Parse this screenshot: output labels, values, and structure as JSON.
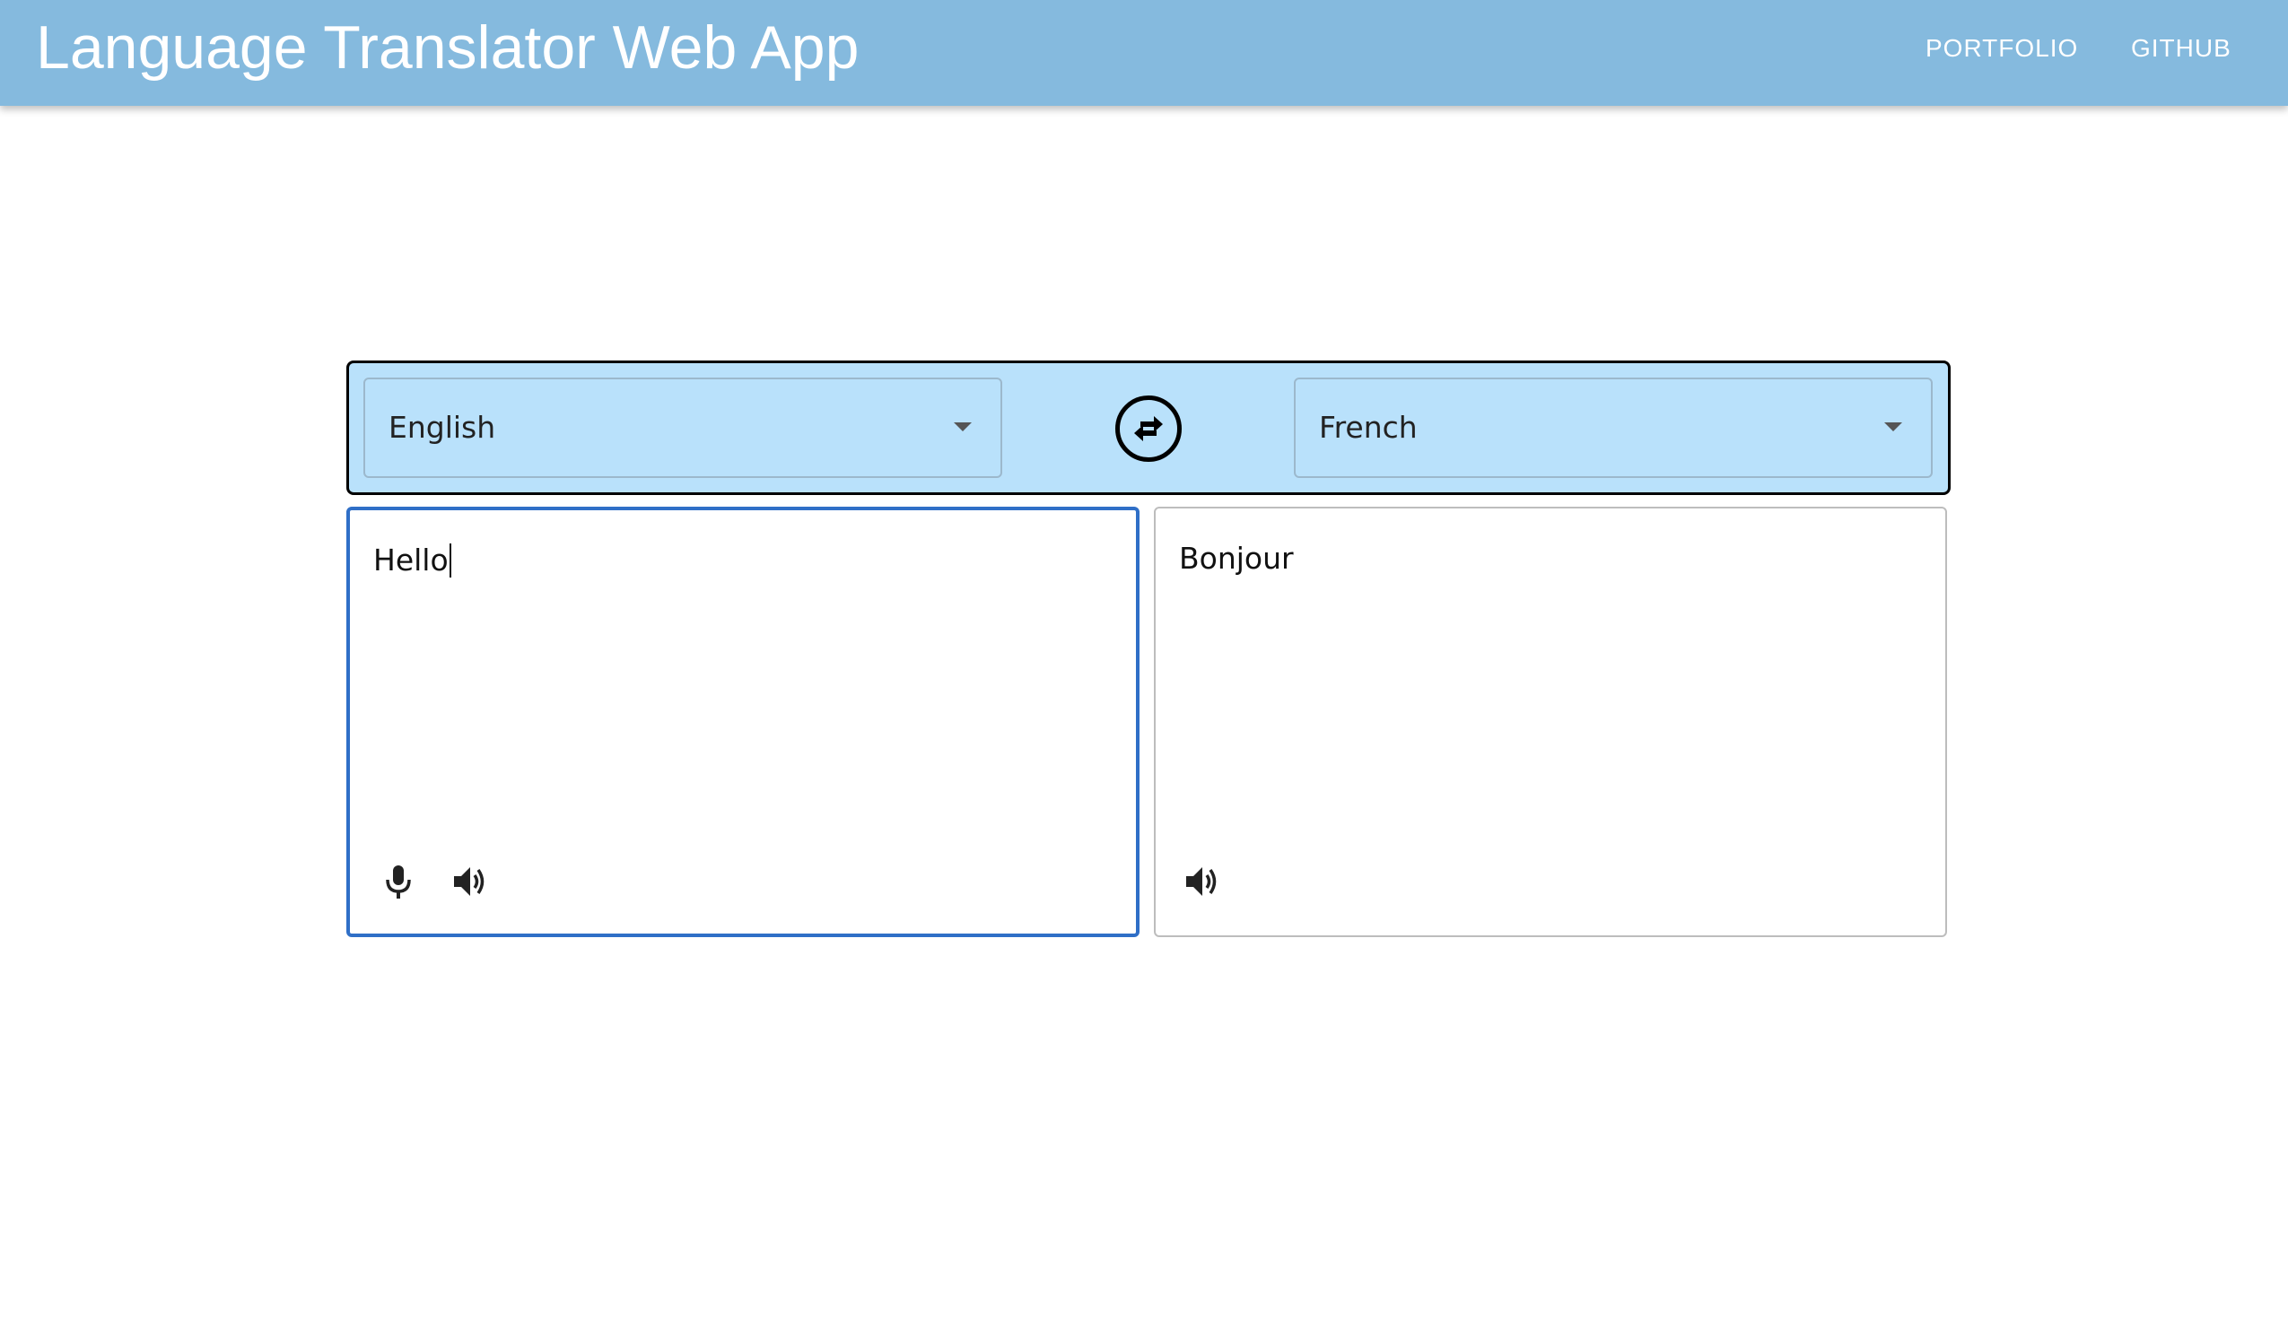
{
  "appbar": {
    "title": "Language Translator Web App",
    "links": [
      {
        "label": "PORTFOLIO"
      },
      {
        "label": "GITHUB"
      }
    ],
    "background_color": "#85bade"
  },
  "language_bar": {
    "source_language": "English",
    "target_language": "French",
    "background_color": "#b9e1fb",
    "swap_icon": "swap-horizontal-icon"
  },
  "source": {
    "text": "Hello",
    "focused": true,
    "border_color": "#2f6fc7",
    "icons": [
      "microphone-icon",
      "speaker-icon"
    ]
  },
  "target": {
    "text": "Bonjour",
    "icons": [
      "speaker-icon"
    ]
  }
}
